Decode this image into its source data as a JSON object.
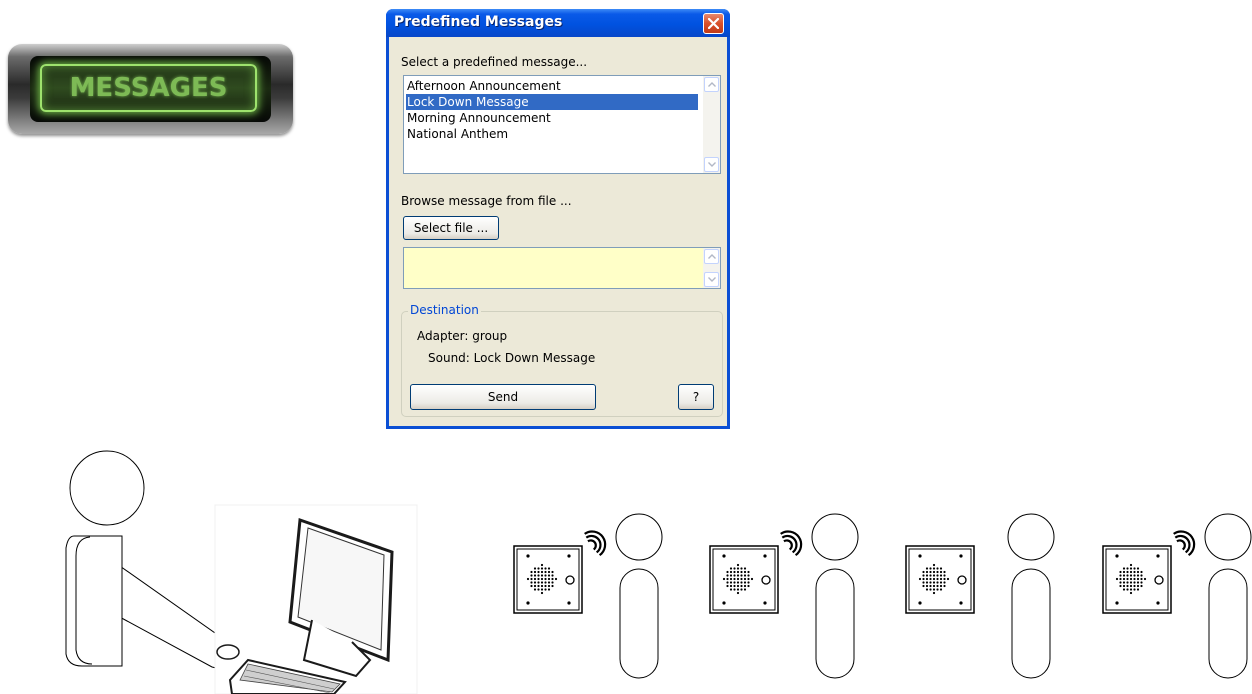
{
  "messages_button": {
    "label": "MESSAGES"
  },
  "dialog": {
    "title": "Predefined Messages",
    "select_prompt": "Select a predefined message...",
    "messages": [
      {
        "label": "Afternoon Announcement",
        "selected": false
      },
      {
        "label": "Lock Down Message",
        "selected": true
      },
      {
        "label": "Morning Announcement",
        "selected": false
      },
      {
        "label": "National Anthem",
        "selected": false
      }
    ],
    "browse_label": "Browse message from file ...",
    "select_file_label": "Select file ...",
    "file_path_value": "",
    "destination": {
      "title": "Destination",
      "adapter_label": "Adapter:",
      "adapter_value": "group",
      "sound_label": "Sound:",
      "sound_value": "Lock Down Message"
    },
    "send_label": "Send",
    "help_label": "?"
  },
  "colors": {
    "titlebar": "#0052e0",
    "selection": "#316ac5",
    "destination_title": "#0046d5",
    "file_field": "#ffffc8",
    "button_glow": "#9ee26d"
  },
  "illustration": {
    "operator": "person-at-computer-icon",
    "speakers": [
      {
        "has_sound_waves": true
      },
      {
        "has_sound_waves": true
      },
      {
        "has_sound_waves": false
      },
      {
        "has_sound_waves": true
      }
    ]
  }
}
